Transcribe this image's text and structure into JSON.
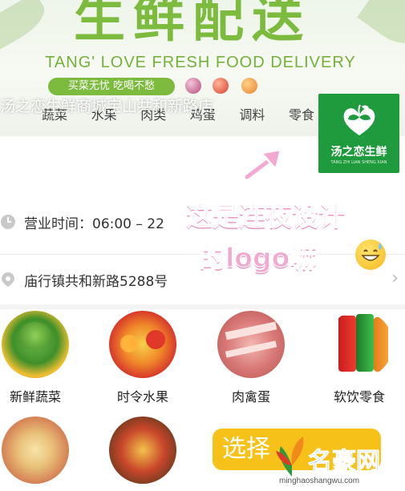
{
  "banner": {
    "title": "生鲜配送",
    "subtitle": "TANG' LOVE FRESH FOOD DELIVERY",
    "slogan": "买菜无忧 吃喝不愁",
    "store_overlay": "汤之恋生鲜商城宝山共和新路店",
    "categories": [
      "蔬菜",
      "水果",
      "肉类",
      "鸡蛋",
      "调料",
      "零食"
    ]
  },
  "logo": {
    "name": "汤之恋生鲜",
    "sub": "TANG ZHI LIAN SHENG XIAN"
  },
  "info": {
    "hours_label": "营业时间：06:00 – 22",
    "address": "庙行镇共和新路5288号"
  },
  "sticker": {
    "line1": "这是连夜设计",
    "line2": "的logo嘛"
  },
  "grid": {
    "items": [
      {
        "label": "新鲜蔬菜",
        "icon": "vegetables-icon"
      },
      {
        "label": "时令水果",
        "icon": "fruit-icon"
      },
      {
        "label": "肉禽蛋",
        "icon": "meat-icon"
      },
      {
        "label": "软饮零食",
        "icon": "soda-icon"
      },
      {
        "label": "",
        "icon": "platter-icon"
      },
      {
        "label": "",
        "icon": "spices-icon"
      }
    ]
  },
  "bottom": {
    "select_label": "选择",
    "watermark_name": "名豪网",
    "watermark_url": "minghaoshangwu.com"
  },
  "colors": {
    "brand_green": "#7dbb3f",
    "logo_green": "#1f9a3c",
    "sticker_pink": "#f3a9cf",
    "button_yellow": "#f6c21a"
  }
}
